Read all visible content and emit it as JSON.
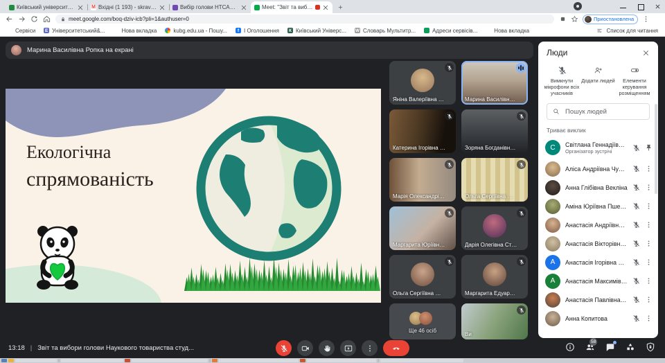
{
  "browser": {
    "tabs": [
      {
        "title": "Київський університет імені Бо...",
        "icon_color": "#1e8e3e",
        "icon_letter": "",
        "active": false
      },
      {
        "title": "Вхідні (1 193) - skravets@kubg...",
        "icon_color": "#ffffff",
        "icon_letter": "M",
        "active": false
      },
      {
        "title": "Вибір голови НТСАДМВ Наукове...",
        "icon_color": "#7248b9",
        "icon_letter": "",
        "active": false
      },
      {
        "title": "Meet: \"Звіт та вибори голов...",
        "icon_color": "#00ac47",
        "icon_letter": "",
        "active": true,
        "has_ext": true
      }
    ],
    "url": "meet.google.com/boq-dziv-icb?pli=1&authuser=0",
    "profile_label": "Приостановлена",
    "bookmarks": [
      {
        "label": "Сервіси",
        "ic": "grid"
      },
      {
        "label": "Університетський&...",
        "ic": "letter",
        "color": "#5c6bc0",
        "letter": "Е"
      },
      {
        "label": "Нова вкладка",
        "ic": "globe"
      },
      {
        "label": "kubg.edu.ua - Пошу...",
        "ic": "g"
      },
      {
        "label": "І Оголошення",
        "ic": "letter",
        "color": "#1877f2",
        "letter": "f"
      },
      {
        "label": "Київський Універс...",
        "ic": "letter",
        "color": "#2e5e4e",
        "letter": "К"
      },
      {
        "label": "Словарь Мультитр...",
        "ic": "letter",
        "color": "#9e9e9e",
        "letter": "W"
      },
      {
        "label": "Адреси сервісів...",
        "ic": "letter",
        "color": "#0f9d58",
        "letter": ""
      },
      {
        "label": "Нова вкладка",
        "ic": "globe"
      }
    ],
    "reading_list": "Список для читання"
  },
  "meet": {
    "banner": "Марина Василівна Ропка на екрані",
    "slide": {
      "title_line1": "Екологічна",
      "title_line2": "спрямованість"
    },
    "slide_colors": {
      "bg": "#faf2e7",
      "blob": "#8e93b8",
      "teal": "#1d7f74",
      "grass": "#2f9e3b",
      "heart": "#15c93f"
    },
    "tiles": [
      {
        "name": "Яніна Валеріївна Карлі...",
        "cls": "avatar",
        "bg": "#3c4043",
        "avatar_bg": "radial-gradient(circle at 50% 38%, #d8b98c, #96765a)",
        "muted": true
      },
      {
        "name": "Марина Василівна Роп...",
        "cls": "video speaking",
        "bg": "linear-gradient(180deg,#cfc9bf,#b3a391 45%,#6f5a4a)",
        "speaking": true
      },
      {
        "name": "Катерина Ігорівна Гав...",
        "cls": "video",
        "bg": "linear-gradient(100deg,#7a5a38,#4a3722 45%,#17110b 80%)",
        "muted": true
      },
      {
        "name": "Зоряна Богданівна Ли...",
        "cls": "video",
        "bg": "linear-gradient(180deg,#5c6063,#33363a 70%,#202326)",
        "muted": true
      },
      {
        "name": "Марія Олександрівна ...",
        "cls": "video",
        "bg": "linear-gradient(90deg,#6e5139,#c3ac90 45%,#958a80)",
        "muted": true
      },
      {
        "name": "Ольга Сергіївна Мусія...",
        "cls": "video",
        "bg": "repeating-linear-gradient(90deg,#e6dcb2 0 7px,#d3c48e 7px 14px)",
        "muted": true
      },
      {
        "name": "Маргарита Юріївна Че...",
        "cls": "video",
        "bg": "linear-gradient(135deg,#9fc0d6,#c5b2a4 55%,#5f4f46)",
        "muted": true
      },
      {
        "name": "Дарія Олегівна Степан...",
        "cls": "avatar",
        "bg": "#3c4043",
        "avatar_bg": "radial-gradient(circle at 45% 35%, #c06a7e, #4e2f5a)",
        "muted": true
      },
      {
        "name": "Ольга Сергіївна Мусіяч...",
        "cls": "avatar",
        "bg": "#3c4043",
        "avatar_bg": "radial-gradient(circle at 50% 38%, #caa58c, #6f4f3e)",
        "muted": true
      },
      {
        "name": "Маргарита Едуардівна ...",
        "cls": "avatar",
        "bg": "#3c4043",
        "avatar_bg": "radial-gradient(circle at 50% 38%, #c9a284, #5e443a)",
        "muted": true
      },
      {
        "name": "Ще 46 осіб",
        "cls": "more",
        "bg": "#46494d",
        "is_more": true
      },
      {
        "name": "Ви",
        "cls": "video",
        "bg": "linear-gradient(120deg,#c2cbcf,#8aa37c 50%,#50764a)",
        "muted": true
      }
    ],
    "bottom": {
      "time": "13:18",
      "sep": "|",
      "title": "Звіт та вибори голови Наукового товариства студ...",
      "badge": "58"
    }
  },
  "people": {
    "title": "Люди",
    "actions": [
      {
        "label": "Вимкнути мікрофони всіх учасників",
        "icon": "micoff"
      },
      {
        "label": "Додати людей",
        "icon": "addperson"
      },
      {
        "label": "Елементи керування розміщенням",
        "icon": "toggle"
      }
    ],
    "search_placeholder": "Пошук людей",
    "section": "Триває виклик",
    "participants": [
      {
        "name": "Світлана Геннадіївн... (Ви)",
        "sub": "Організатор зустрічі",
        "av": "#00897b",
        "letter": "С",
        "pinned": true,
        "first": true
      },
      {
        "name": "Аліса Андріївна Чумачен...",
        "av": "radial-gradient(circle at 50% 38%, #d9bd92, #8a6b4a)",
        "dots": true
      },
      {
        "name": "Анна Глібівна Векліна",
        "av": "radial-gradient(circle at 50% 38%, #5a4c44, #211b18)",
        "dots": true
      },
      {
        "name": "Аміна Юріївна Пшенкова...",
        "av": "radial-gradient(circle at 50% 38%, #a8ad74, #555b35)",
        "dots": true
      },
      {
        "name": "Анастасія Андріївна Кра...",
        "av": "radial-gradient(circle at 50% 38%, #d7b393, #7e5c43)",
        "dots": true
      },
      {
        "name": "Анастасія Вікторівна Сп...",
        "av": "radial-gradient(circle at 50% 38%, #cfc0a6, #8a7a5e)",
        "dots": true
      },
      {
        "name": "Анастасія Ігорівна Яковен...",
        "av": "#1a73e8",
        "letter": "А",
        "dots": true
      },
      {
        "name": "Анастасія Максимівна П...",
        "av": "#188038",
        "letter": "А",
        "dots": true
      },
      {
        "name": "Анастасія Павлівна Третяк",
        "av": "radial-gradient(circle at 50% 38%, #c77f50, #54433c)",
        "dots": true
      },
      {
        "name": "Анна Копитова",
        "av": "radial-gradient(circle at 50% 38%, #c9b39a, #6e5a48)",
        "dots": true
      }
    ]
  }
}
